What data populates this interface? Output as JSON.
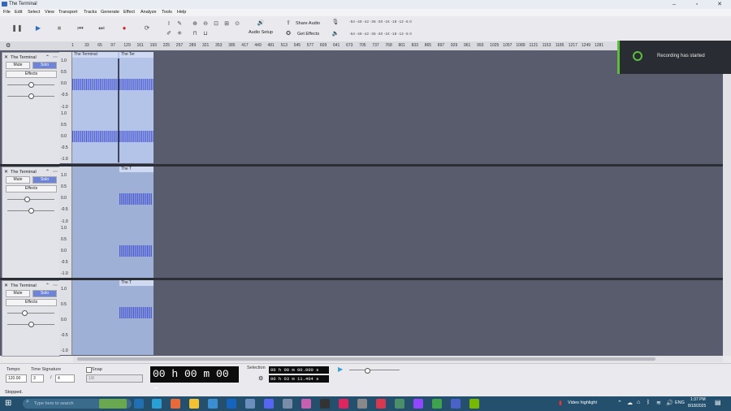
{
  "window": {
    "title": "The Terminal"
  },
  "menu": [
    "File",
    "Edit",
    "Select",
    "View",
    "Transport",
    "Tracks",
    "Generate",
    "Effect",
    "Analyze",
    "Tools",
    "Help"
  ],
  "toolbar": {
    "audio_setup": "Audio Setup",
    "share_audio": "Share Audio",
    "get_effects": "Get Effects",
    "meter_ticks": "-54 -48 -42 -36 -30 -24 -18 -12 -6 0",
    "meter_ticks2": "-54 -48 -42 -36 -30 -24 -18 -12 -6 0"
  },
  "ruler": [
    "1",
    "33",
    "65",
    "97",
    "129",
    "161",
    "193",
    "225",
    "257",
    "289",
    "321",
    "353",
    "385",
    "417",
    "449",
    "481",
    "513",
    "545",
    "577",
    "609",
    "641",
    "673",
    "705",
    "737",
    "768",
    "801",
    "833",
    "865",
    "897",
    "929",
    "961",
    "993",
    "1025",
    "1057",
    "1089",
    "1121",
    "1153",
    "1185",
    "1217",
    "1249",
    "1281"
  ],
  "tracks": [
    {
      "name": "The Terminal",
      "mute": "Mute",
      "solo": "Solo",
      "effects": "Effects",
      "clip1": "The Terminal",
      "clip2": "The Ter"
    },
    {
      "name": "The Terminal",
      "mute": "Mute",
      "solo": "Solo",
      "effects": "Effects",
      "clip2": "The T"
    },
    {
      "name": "The Terminal",
      "mute": "Mute",
      "solo": "Solo",
      "effects": "Effects",
      "clip2": "The T"
    }
  ],
  "scale_labels": [
    "1.0",
    "0.5",
    "0.0",
    "-0.5",
    "-1.0"
  ],
  "toast": {
    "message": "Recording has started"
  },
  "bottom": {
    "tempo_label": "Tempo",
    "tempo_value": "120.00",
    "timesig_label": "Time Signature",
    "timesig_num": "3",
    "timesig_den": "4",
    "snap_label": "Snap",
    "snap_value": "1/8",
    "time_display": "00 h 00 m 00 s",
    "selection_label": "Selection",
    "sel_start": "00 h 00 m 00.000 s",
    "sel_end": "00 h 03 m 11.404 s"
  },
  "status": {
    "text": "Stopped."
  },
  "taskbar": {
    "search_placeholder": "Type here to search",
    "video_highlight": "Video highlight",
    "lang": "ENG",
    "time": "1:37 PM",
    "date": "8/18/2025"
  }
}
